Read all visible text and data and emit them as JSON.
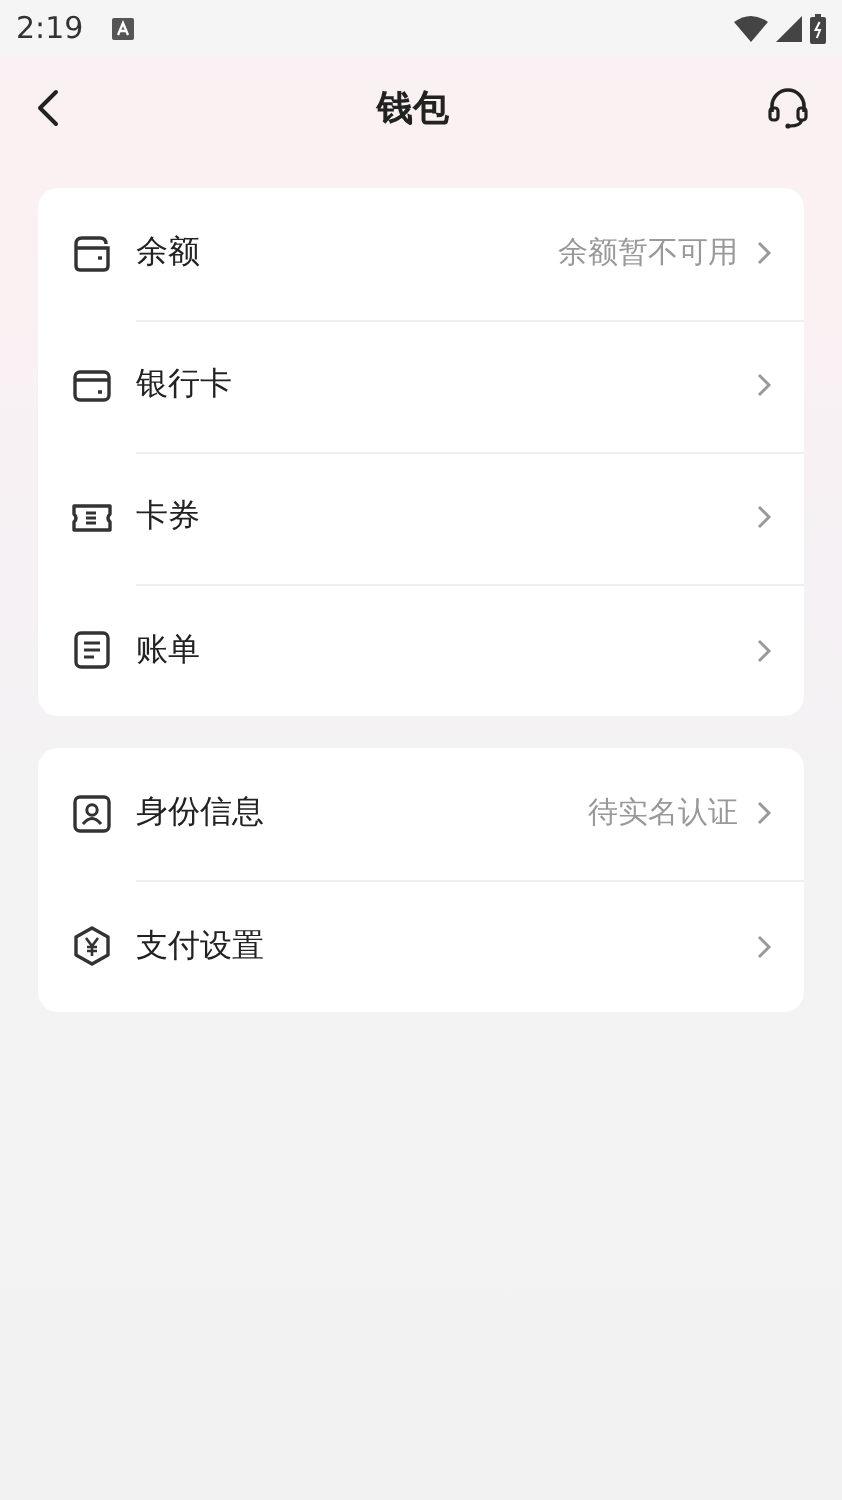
{
  "status_bar": {
    "time": "2:19"
  },
  "header": {
    "title": "钱包"
  },
  "groups": [
    {
      "items": [
        {
          "kind": "wallet",
          "label": "余额",
          "value": "余额暂不可用"
        },
        {
          "kind": "card",
          "label": "银行卡"
        },
        {
          "kind": "coupon",
          "label": "卡券"
        },
        {
          "kind": "bill",
          "label": "账单"
        }
      ]
    },
    {
      "items": [
        {
          "kind": "id",
          "label": "身份信息",
          "value": "待实名认证"
        },
        {
          "kind": "pay",
          "label": "支付设置"
        }
      ]
    }
  ]
}
